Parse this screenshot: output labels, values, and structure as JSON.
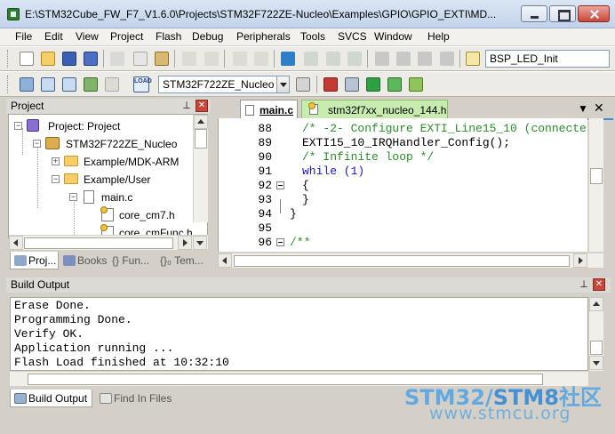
{
  "window": {
    "title": "E:\\STM32Cube_FW_F7_V1.6.0\\Projects\\STM32F722ZE-Nucleo\\Examples\\GPIO\\GPIO_EXTI\\MD..."
  },
  "menu": [
    "File",
    "Edit",
    "View",
    "Project",
    "Flash",
    "Debug",
    "Peripherals",
    "Tools",
    "SVCS",
    "Window",
    "Help"
  ],
  "toolbar": {
    "function_combo": "BSP_LED_Init",
    "target_combo": "STM32F722ZE_Nucleo"
  },
  "project_panel": {
    "title": "Project",
    "tree": [
      {
        "label": "Project: Project",
        "icon": "project-icon",
        "expander": "−"
      },
      {
        "label": "STM32F722ZE_Nucleo",
        "icon": "target-icon",
        "expander": "−"
      },
      {
        "label": "Example/MDK-ARM",
        "icon": "folder-icon",
        "expander": "+"
      },
      {
        "label": "Example/User",
        "icon": "folder-icon",
        "expander": "−"
      },
      {
        "label": "main.c",
        "icon": "file-icon",
        "expander": "−"
      },
      {
        "label": "core_cm7.h",
        "icon": "header-file-icon",
        "expander": ""
      },
      {
        "label": "core_cmFunc.h",
        "icon": "header-file-icon",
        "expander": ""
      }
    ],
    "tabs": [
      "Proj...",
      "Books",
      "{} Fun...",
      "{}₀ Tem..."
    ]
  },
  "editor": {
    "tabs": [
      "main.c",
      "stm32f7xx_nucleo_144.h"
    ],
    "lines": [
      {
        "num": "88",
        "text": "/* -2- Configure EXTI_Line15_10 (connecte",
        "kind": "cmt",
        "fold": ""
      },
      {
        "num": "89",
        "text": "EXTI15_10_IRQHandler_Config();",
        "kind": "code",
        "fold": ""
      },
      {
        "num": "90",
        "text": "/* Infinite loop */",
        "kind": "cmt",
        "fold": ""
      },
      {
        "num": "91",
        "text": "while (1)",
        "kind": "kw",
        "fold": ""
      },
      {
        "num": "92",
        "text": "{",
        "kind": "code",
        "fold": "box"
      },
      {
        "num": "93",
        "text": "}",
        "kind": "code",
        "fold": ""
      },
      {
        "num": "94",
        "text": "}",
        "kind": "code",
        "fold": ""
      },
      {
        "num": "95",
        "text": "",
        "kind": "code",
        "fold": ""
      },
      {
        "num": "96",
        "text": "/**",
        "kind": "cmt",
        "fold": "box"
      }
    ]
  },
  "build_output": {
    "title": "Build Output",
    "lines": [
      "Erase Done.",
      "Programming Done.",
      "Verify OK.",
      "Application running ...",
      "Flash Load finished at 10:32:10"
    ],
    "tabs": [
      "Build Output",
      "Find In Files"
    ]
  },
  "watermark": {
    "line1a": "STM32/",
    "line1b": "STM8",
    "line1c": "社区",
    "line2": "www.stmcu.org"
  },
  "colors": {
    "accent_blue": "#3c8fd6",
    "watermark_blue": "#4fa3e6",
    "comment_green": "#2a8c2a",
    "keyword_blue": "#1a1ad0"
  }
}
